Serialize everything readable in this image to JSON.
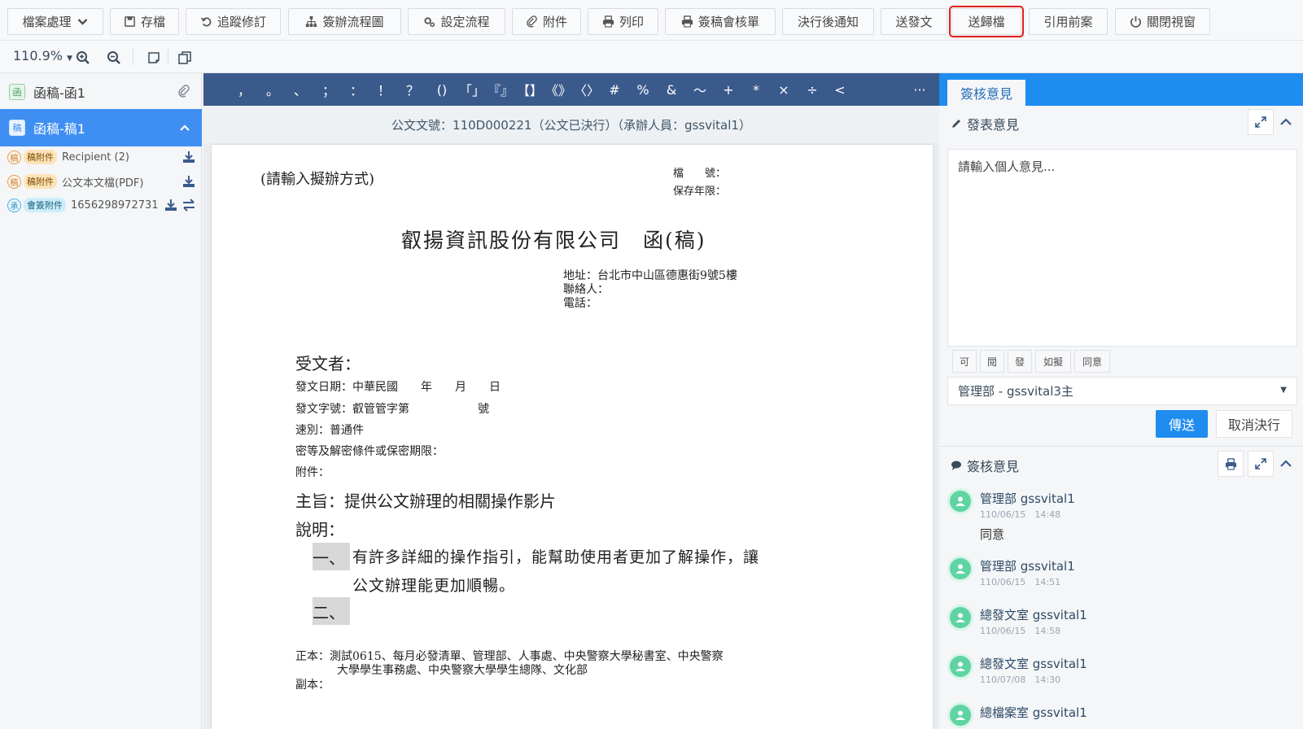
{
  "toolbar": {
    "file_menu": "檔案處理",
    "save": "存檔",
    "track_changes": "追蹤修訂",
    "flow_chart": "簽辦流程圖",
    "set_flow": "設定流程",
    "attachment": "附件",
    "print": "列印",
    "review_sheet": "簽稿會核單",
    "notify_after": "決行後通知",
    "send_document": "送發文",
    "send_archive": "送歸檔",
    "cite_previous": "引用前案",
    "close_window": "關閉視窗"
  },
  "zoom": {
    "value": "110.9%"
  },
  "sidebar": {
    "doc1": {
      "icon": "函",
      "label": "函稿-函1"
    },
    "doc2": {
      "icon": "稿",
      "label": "函稿-稿1"
    },
    "attachments": [
      {
        "circle": "稿",
        "tag": "稿附件",
        "name": "Recipient (2)"
      },
      {
        "circle": "稿",
        "tag": "稿附件",
        "name": "公文本文檔(PDF)"
      },
      {
        "circle": "承",
        "tag": "會簽附件",
        "name": "1656298972731"
      }
    ]
  },
  "symbols": [
    "，",
    "。",
    "、",
    "；",
    "：",
    "！",
    "？",
    "()",
    "「」",
    "『』",
    "【】",
    "《》",
    "〈〉",
    "#",
    "%",
    "&",
    "～",
    "+",
    "*",
    "×",
    "÷",
    "<",
    "···"
  ],
  "doc_header": "公文文號：110D000221（公文已決行）（承辦人員：gssvital1）",
  "paper": {
    "method": "(請輸入擬辦方式)",
    "file_no": "檔　　號：",
    "keep_years": "保存年限：",
    "title": "叡揚資訊股份有限公司　函(稿)",
    "address": "地址：台北市中山區德惠街9號5樓",
    "contact": "聯絡人：",
    "phone": "電話：",
    "recipient": "受文者：",
    "date": "發文日期：中華民國　　年　　月　　日",
    "ref_no": "發文字號：叡管管字第　　　　　　號",
    "speed": "速別：普通件",
    "secrecy": "密等及解密條件或保密期限：",
    "attach": "附件：",
    "subject": "主旨：提供公文辦理的相關操作影片",
    "explain": "說明：",
    "item1_no": "一、",
    "item1_line1": "有許多詳細的操作指引，能幫助使用者更加了解操作，讓",
    "item1_line2": "公文辦理能更加順暢。",
    "item2_no": "二、",
    "main_recv": "正本：測試0615、每月必發清單、管理部、人事處、中央警察大學秘書室、中央警察",
    "main_recv2": "大學學生事務處、中央警察大學學生總隊、文化部",
    "cc": "副本："
  },
  "right_panel": {
    "tab": "簽核意見",
    "post_title": "發表意見",
    "placeholder": "請輸入個人意見...",
    "quick": [
      "可",
      "閱",
      "發",
      "如擬",
      "同意"
    ],
    "dept": "管理部 - gssvital3主",
    "send": "傳送",
    "cancel": "取消決行",
    "list_title": "簽核意見",
    "comments": [
      {
        "name": "管理部 gssvital1",
        "time": "110/06/15　14:48",
        "text": "同意"
      },
      {
        "name": "管理部 gssvital1",
        "time": "110/06/15　14:51",
        "text": ""
      },
      {
        "name": "總發文室 gssvital1",
        "time": "110/06/15　14:58",
        "text": ""
      },
      {
        "name": "總發文室 gssvital1",
        "time": "110/07/08　14:30",
        "text": ""
      },
      {
        "name": "總檔案室 gssvital1",
        "time": "",
        "text": ""
      }
    ]
  },
  "colors": {
    "accent": "#1f8cf0",
    "symbolbar": "#3b5a8c",
    "highlight": "#e0201b",
    "active_doc": "#3f8ff2"
  }
}
